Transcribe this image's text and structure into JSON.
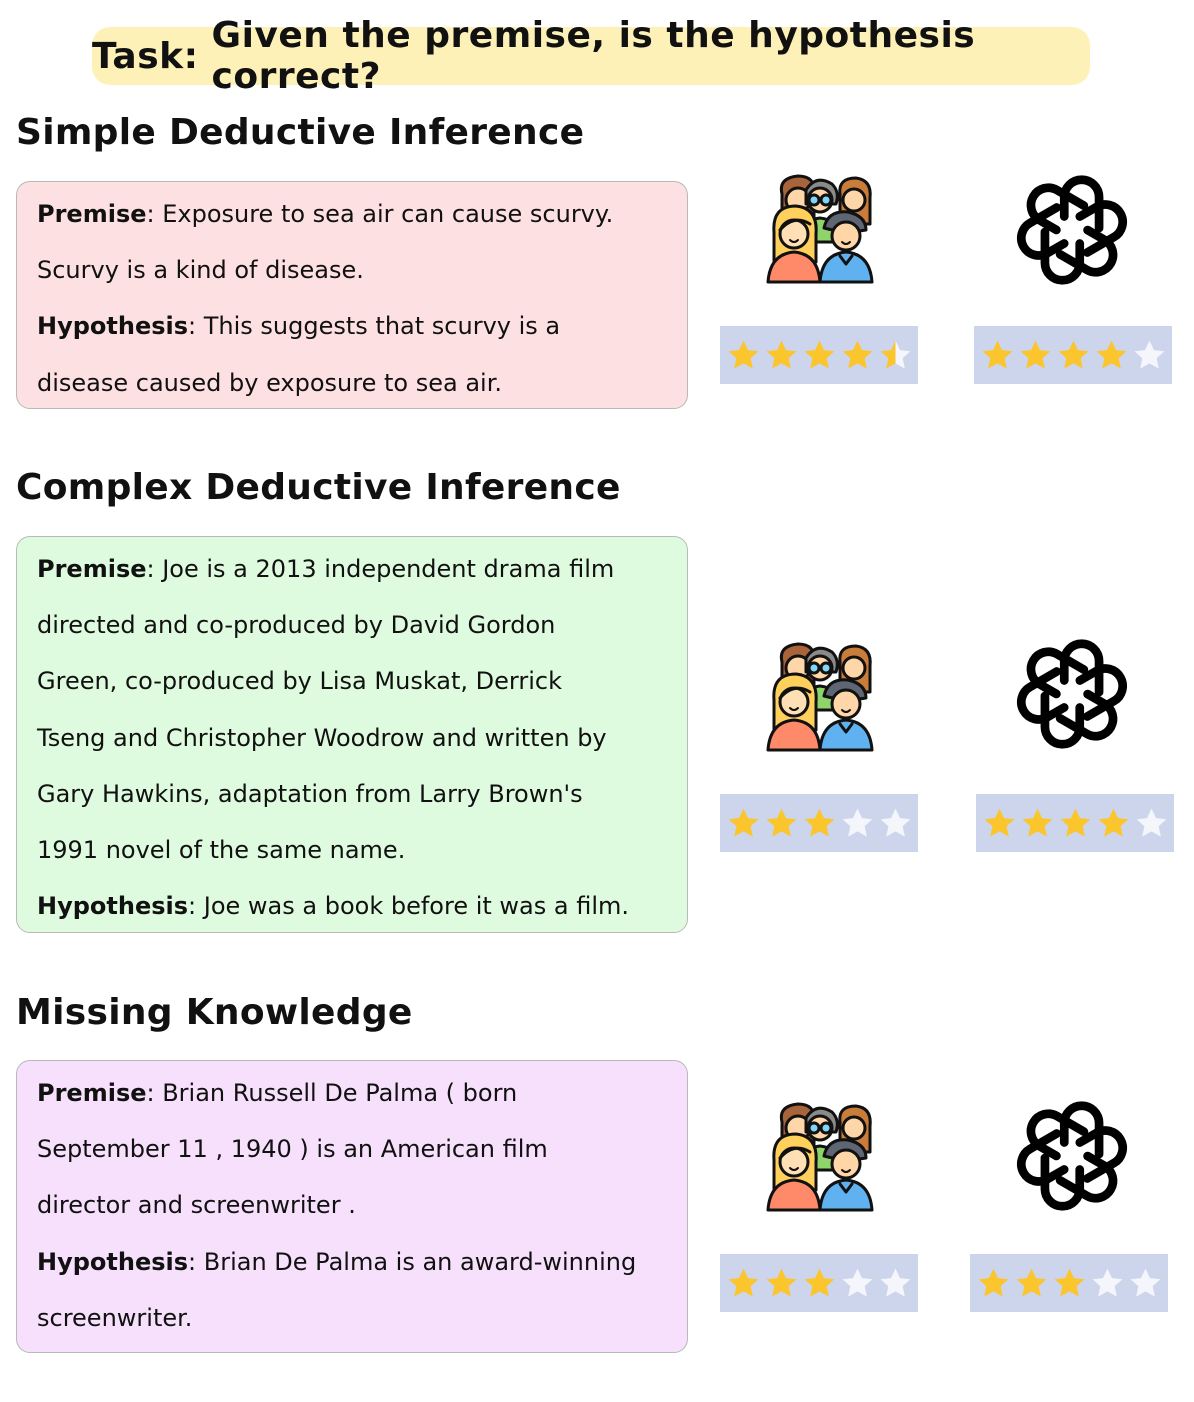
{
  "task": {
    "label": "Task:",
    "text": "Given the premise, is the hypothesis correct?"
  },
  "labels": {
    "premise": "Premise",
    "hypothesis": "Hypothesis"
  },
  "colors": {
    "task_bg": "#fdf1b8",
    "star_filled": "#fbc52d",
    "star_empty": "#f4f6fb",
    "rating_bg": "#cdd5ec"
  },
  "icons": {
    "human": "people-group-icon",
    "model": "openai-logo-icon"
  },
  "sections": [
    {
      "title": "Simple Deductive Inference",
      "box_color": "#fde0e1",
      "premise_lines": [
        "Exposure to sea air can cause scurvy.",
        "Scurvy is a kind of disease."
      ],
      "hypothesis_lines": [
        "This suggests that scurvy is a",
        "disease caused by exposure to sea air."
      ],
      "human_rating": 4.5,
      "gpt_rating": 4,
      "max_rating": 5
    },
    {
      "title": "Complex Deductive Inference",
      "box_color": "#dffbdf",
      "premise_lines": [
        "Joe is a 2013 independent drama film",
        "directed and co-produced by David Gordon",
        "Green, co-produced by Lisa Muskat, Derrick",
        "Tseng and Christopher Woodrow and written by",
        "Gary Hawkins, adaptation from Larry Brown's",
        "1991 novel of the same name."
      ],
      "hypothesis_lines": [
        "Joe was a book before it was a film."
      ],
      "human_rating": 3,
      "gpt_rating": 4,
      "max_rating": 5
    },
    {
      "title": "Missing Knowledge",
      "box_color": "#f6e0fb",
      "premise_lines": [
        "Brian Russell De Palma ( born",
        "September 11 , 1940 ) is an American film",
        "director and screenwriter ."
      ],
      "hypothesis_lines": [
        "Brian De Palma is an award-winning",
        "screenwriter."
      ],
      "human_rating": 3,
      "gpt_rating": 3,
      "max_rating": 5
    }
  ]
}
